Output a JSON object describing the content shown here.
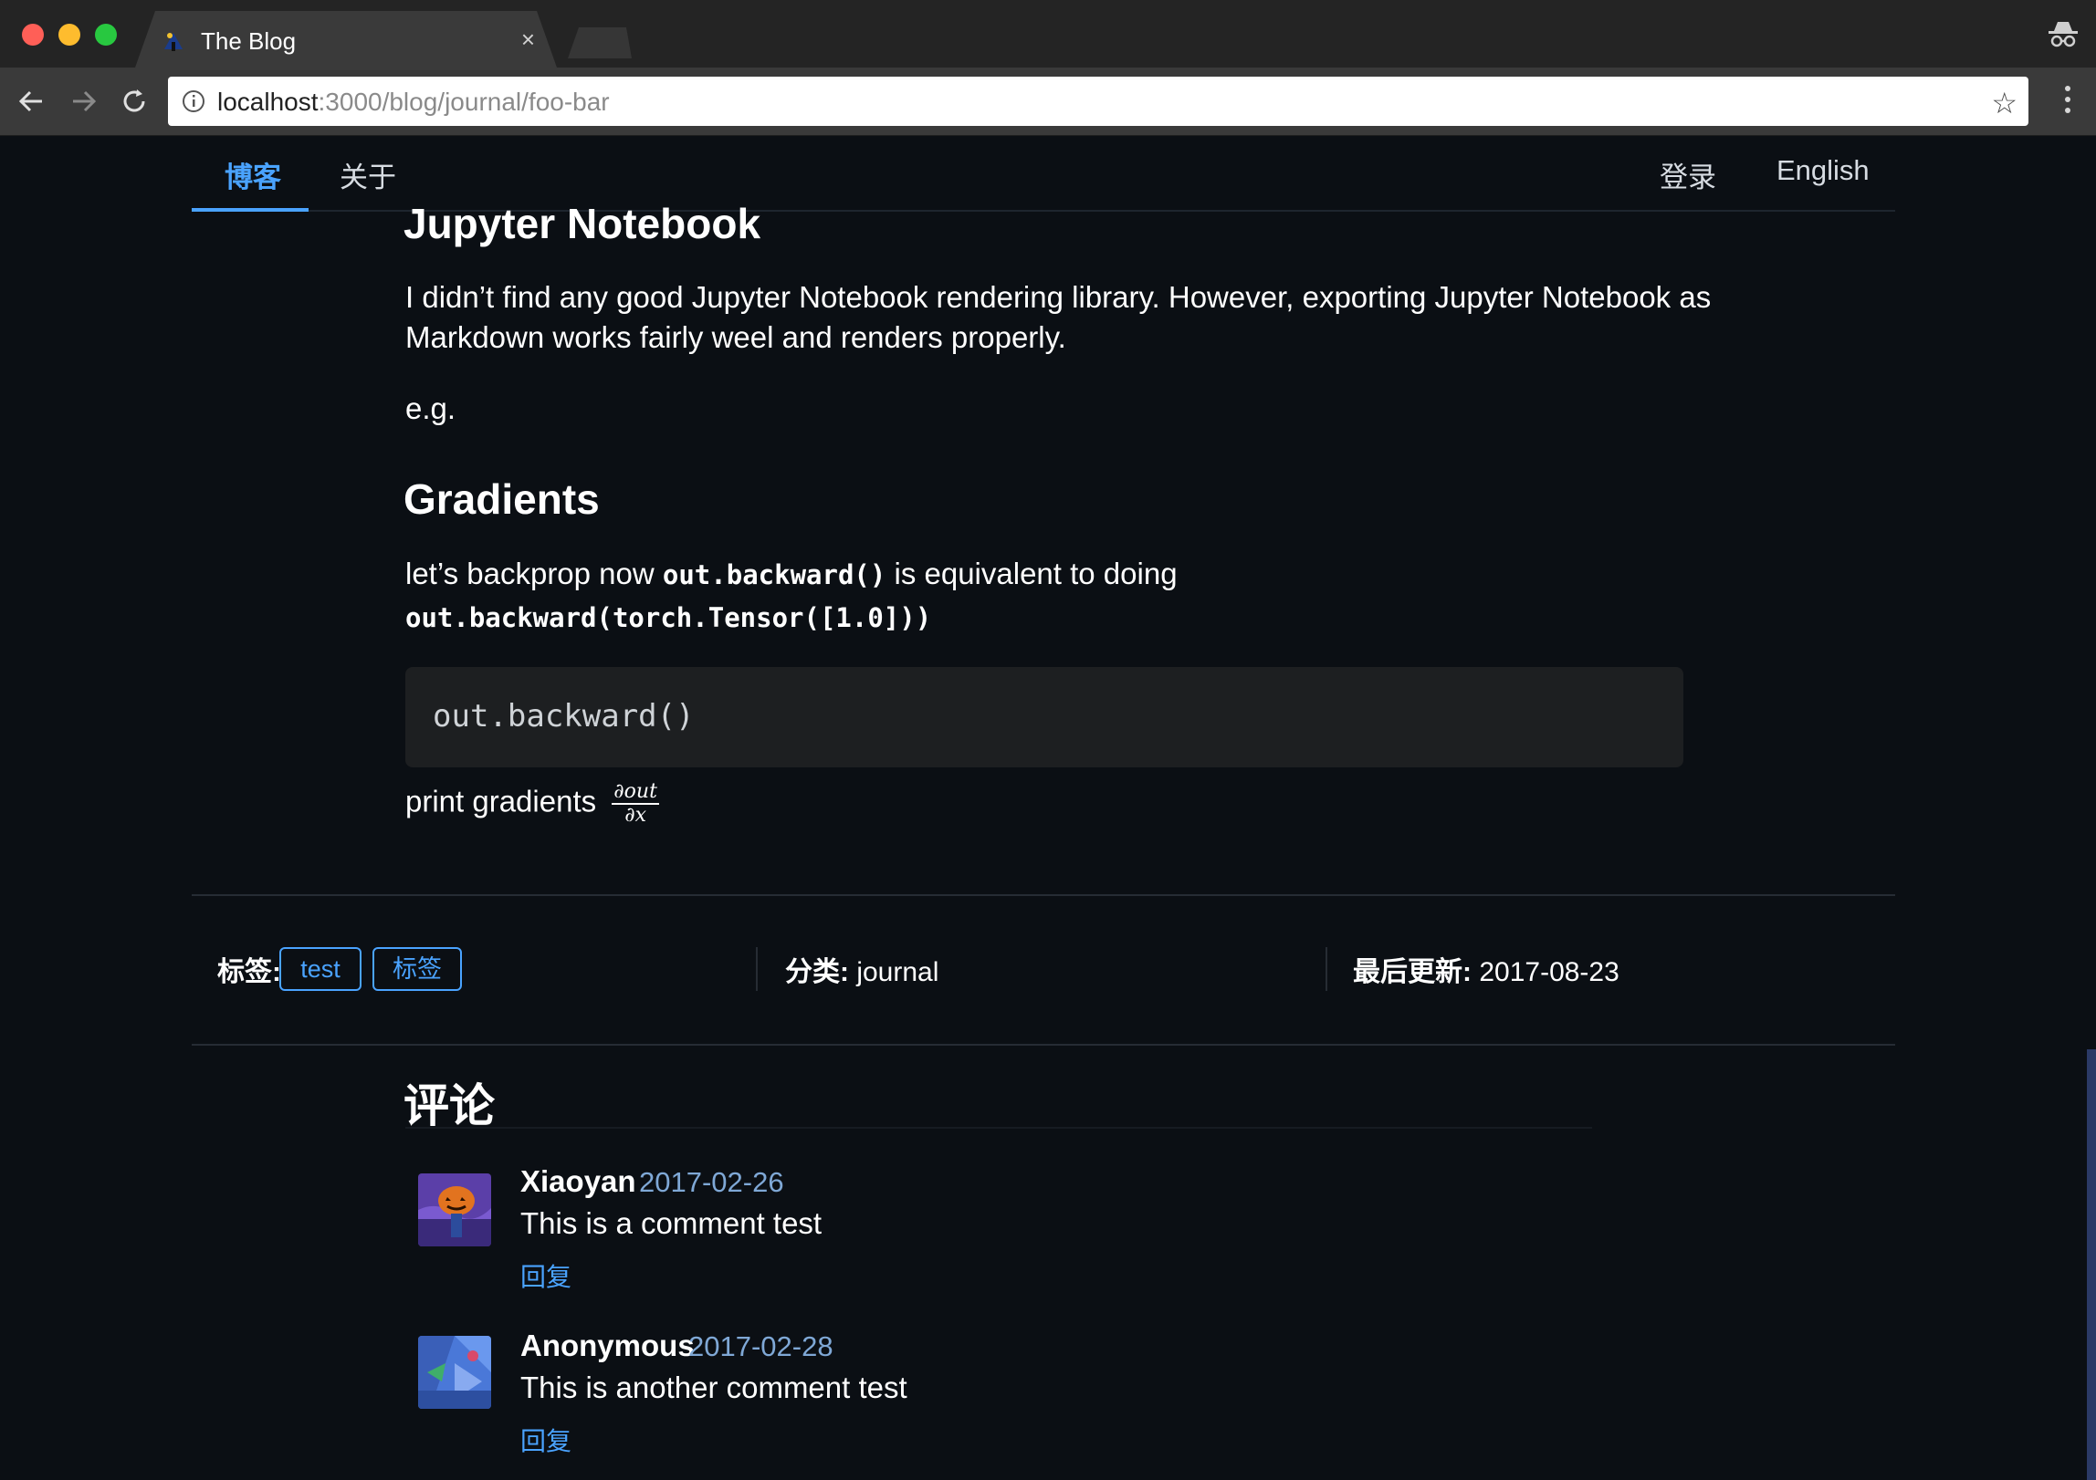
{
  "browser": {
    "tab_title": "The Blog",
    "tab_close": "×",
    "url_host": "localhost",
    "url_rest": ":3000/blog/journal/foo-bar",
    "star": "☆"
  },
  "site_nav": {
    "items": [
      {
        "label": "博客",
        "active": true
      },
      {
        "label": "关于",
        "active": false
      }
    ],
    "login": "登录",
    "language": "English"
  },
  "article": {
    "h_jupyter": "Jupyter Notebook",
    "p_jupyter_line1": "I didn’t find any good Jupyter Notebook rendering library. However, exporting Jupyter Notebook as",
    "p_jupyter_line2": "Markdown works fairly weel and renders properly.",
    "p_eg": "e.g.",
    "h_gradients": "Gradients",
    "p_backprop_pre": "let’s backprop now ",
    "p_backprop_code1": "out.backward()",
    "p_backprop_post": " is equivalent to doing",
    "p_backprop_code2": "out.backward(torch.Tensor([1.0]))",
    "code_block": "out.backward()",
    "p_print": "print gradients",
    "frac_num": "∂out",
    "frac_den": "∂x"
  },
  "meta": {
    "tags_label": "标签:",
    "tags": [
      "test",
      "标签"
    ],
    "category_label": "分类:",
    "category_value": " journal",
    "updated_label": "最后更新:",
    "updated_value": " 2017-08-23"
  },
  "comments": {
    "title": "评论",
    "items": [
      {
        "author": "Xiaoyan",
        "date": "2017-02-26",
        "text": "This is a comment test",
        "reply": "回复"
      },
      {
        "author": "Anonymous",
        "date": "2017-02-28",
        "text": "This is another comment test",
        "reply": "回复"
      }
    ]
  },
  "colors": {
    "accent": "#4aa3ff",
    "background": "#0b0f14",
    "date": "#7fa8d6"
  }
}
